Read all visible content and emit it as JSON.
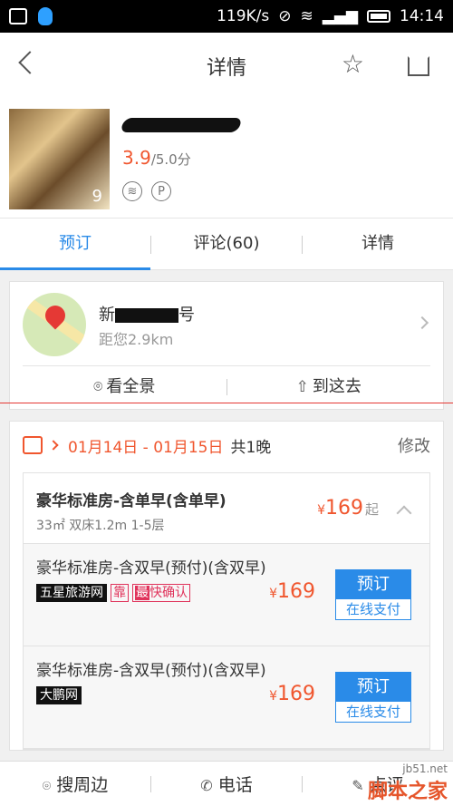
{
  "status_bar": {
    "network_speed": "119K/s",
    "time": "14:14"
  },
  "nav": {
    "title": "详情"
  },
  "hotel": {
    "photo_count": "9",
    "score": "3.9",
    "score_max": "/5.0分"
  },
  "tabs": [
    {
      "label": "预订"
    },
    {
      "label": "评论(60)"
    },
    {
      "label": "详情"
    }
  ],
  "location": {
    "address_prefix": "新",
    "address_suffix": "号",
    "distance": "距您2.9km",
    "actions": [
      {
        "label": "看全景"
      },
      {
        "label": "到这去"
      }
    ]
  },
  "booking": {
    "dates": "01月14日 - 01月15日",
    "nights": "共1晚",
    "modify_label": "修改",
    "room": {
      "name": "豪华标准房-含单早(含单早)",
      "info": "33㎡ 双床1.2m 1-5层",
      "currency": "¥",
      "price": "169",
      "from_label": "起"
    },
    "offers": [
      {
        "name": "豪华标准房-含双早(预付)(含双早)",
        "tags": [
          {
            "text": "五星旅游网"
          }
        ],
        "tag_reliable": "靠",
        "tag_confirm_prefix": "最",
        "tag_confirm": "快确认",
        "currency": "¥",
        "price": "169",
        "book_label": "预订",
        "pay_label": "在线支付"
      },
      {
        "name": "豪华标准房-含双早(预付)(含双早)",
        "tags": [
          {
            "text": "大鹏网"
          }
        ],
        "currency": "¥",
        "price": "169",
        "book_label": "预订",
        "pay_label": "在线支付"
      }
    ]
  },
  "bottom_bar": [
    {
      "label": "搜周边"
    },
    {
      "label": "电话"
    },
    {
      "label": "点评"
    }
  ],
  "watermark": {
    "line1": "jb51.net",
    "line2": "脚本之家"
  }
}
